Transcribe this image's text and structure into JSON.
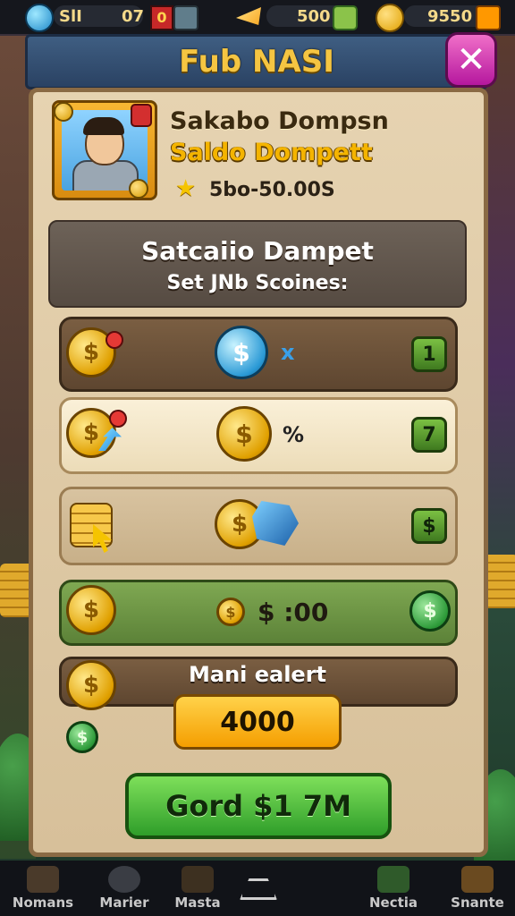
{
  "top_bar": {
    "left_label": "SlI",
    "left_value": "07",
    "red_box_value": "0",
    "mid_value": "500",
    "right_value": "9550"
  },
  "header": {
    "title": "Fub NASI",
    "close_label": "✕"
  },
  "profile": {
    "name_primary": "Sakabo Dompsn",
    "name_secondary": "Saldo Dompett",
    "star_icon": "★",
    "score": "5bo-50.00S"
  },
  "subtitle": {
    "line1": "Satcaiio Dampet",
    "line2": "Set JNb Scoines:"
  },
  "rows": [
    {
      "symbol": "x",
      "badge": "1"
    },
    {
      "symbol": "%",
      "badge": "7"
    },
    {
      "symbol": "",
      "badge": "$"
    },
    {
      "amount": "$ :00",
      "badge": "$"
    }
  ],
  "manual": {
    "label": "Mani ealert",
    "amount": "4000"
  },
  "confirm_button": "Gord $1 7M",
  "bottom_nav": [
    {
      "label": "Nomans"
    },
    {
      "label": "Marier"
    },
    {
      "label": "Masta"
    },
    {
      "label": "Nectia"
    },
    {
      "label": "Snante"
    }
  ],
  "colors": {
    "gold": "#f5c542",
    "close_pink": "#d63ab8",
    "confirm_green": "#3fae32",
    "amount_orange": "#f7b400",
    "panel_parchment": "#e3cfab"
  }
}
